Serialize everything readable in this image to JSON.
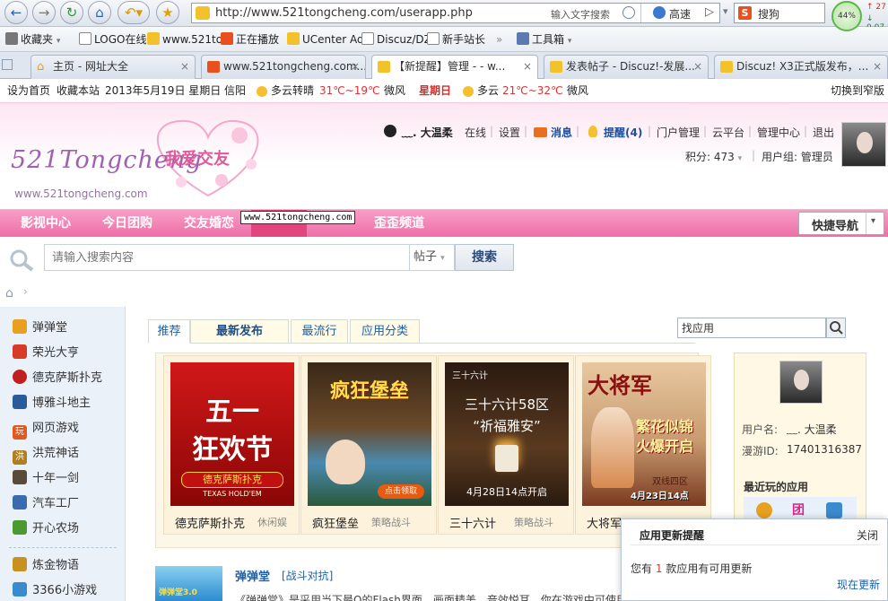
{
  "browser": {
    "url": "http://www.521tongcheng.com/userapp.php",
    "url_hint": "输入文字搜索",
    "speed_label": "高速",
    "search_engine_label": "搜狗",
    "progress_percent_label": "44%",
    "speed_up": "27",
    "speed_down": "0.07"
  },
  "bookmarks": [
    "收藏夹",
    "LOGO在线",
    "www.521to",
    "正在播放",
    "UCenter Ad",
    "Discuz/DZ",
    "新手站长",
    "工具箱"
  ],
  "tabs": [
    {
      "label": "主页 - 网址大全",
      "active": false
    },
    {
      "label": "www.521tongcheng.com...",
      "active": false
    },
    {
      "label": "【新提醒】管理 - - w...",
      "active": true
    },
    {
      "label": "发表帖子 - Discuz!-发展...",
      "active": false
    },
    {
      "label": "Discuz! X3正式版发布，..."
    }
  ],
  "topinfo": {
    "set_home": "设为首页",
    "bookmark_site": "收藏本站",
    "date": "2013年5月19日 星期日",
    "city": "信阳",
    "weather1": "多云转晴",
    "temp1": "31℃~19℃",
    "wind1": "微风",
    "day2": "星期日",
    "weather2": "多云",
    "temp2": "21℃~32℃",
    "wind2": "微风",
    "switch_narrow": "切换到窄版"
  },
  "logo": {
    "main": "521Tongcheng",
    "slogan": "我爱交友",
    "domain": "www.521tongcheng.com"
  },
  "user_nav": {
    "username": "﹏. 大温柔",
    "status": "在线",
    "settings": "设置",
    "messages": "消息",
    "alerts": "提醒(4)",
    "portal_admin": "门户管理",
    "cloud": "云平台",
    "admin_center": "管理中心",
    "logout": "退出",
    "points": "积分: 473",
    "user_group": "用户组: 管理员"
  },
  "menu": {
    "items": [
      "影视中心",
      "今日团购",
      "交友婚恋",
      "",
      "",
      "歪歪频道"
    ],
    "tooltip": "www.521tongcheng.com",
    "quick_nav": "快捷导航"
  },
  "search": {
    "placeholder": "请输入搜索内容",
    "type": "帖子",
    "button": "搜索"
  },
  "sidebar": {
    "items": [
      {
        "label": "弹弹堂",
        "color": "#e8a020"
      },
      {
        "label": "荣光大亨",
        "color": "#d83a2a"
      },
      {
        "label": "德克萨斯扑克",
        "color": "#c02020"
      },
      {
        "label": "博雅斗地主",
        "color": "#2a5a9a"
      },
      {
        "label": "网页游戏",
        "color": "#e05a20"
      },
      {
        "label": "洪荒神话",
        "color": "#b08020"
      },
      {
        "label": "十年一剑",
        "color": "#5a4a3a"
      },
      {
        "label": "汽车工厂",
        "color": "#3a6ab0"
      },
      {
        "label": "开心农场",
        "color": "#4a9a30"
      },
      {
        "label": "炼金物语",
        "color": "#c89020"
      },
      {
        "label": "3366小游戏",
        "color": "#3a8ad0"
      }
    ]
  },
  "app_tabs": [
    "推荐",
    "最新发布",
    "最流行",
    "应用分类"
  ],
  "app_search_placeholder": "找应用",
  "games": [
    {
      "name": "德克萨斯扑克",
      "type": "休闲娱",
      "banner_line1": "五一",
      "banner_line2": "狂欢节",
      "banner_sub": "德克萨斯扑克",
      "banner_sub2": "TEXAS HOLD'EM"
    },
    {
      "name": "疯狂堡垒",
      "type": "策略战斗",
      "banner_line1": "疯狂堡垒",
      "banner_sub": "点击领取"
    },
    {
      "name": "三十六计",
      "type": "策略战斗",
      "banner_line1": "三十六计",
      "banner_line2": "三十六计58区",
      "banner_line3": "“祈福雅安”",
      "banner_sub": "4月28日14点开启"
    },
    {
      "name": "大将军",
      "type": "",
      "banner_line1": "大将军",
      "banner_line2": "繁花似锦",
      "banner_line3": "火爆开启",
      "banner_sub": "双线四区",
      "banner_sub2": "4月23日14点"
    }
  ],
  "user_panel": {
    "username_label": "用户名:",
    "username": "﹏. 大温柔",
    "manyou_label": "漫游ID:",
    "manyou_id": "17401316387",
    "recent_apps": "最近玩的应用",
    "recent_app_glyph": "团"
  },
  "featured": {
    "title": "弹弹堂",
    "tag": "[战斗对抗]",
    "desc": "《弹弹堂》是采用当下最Q的Flash界面，画面精美，音效悦耳，你在游戏中可使用",
    "thumb_text": "弹弹堂3.0"
  },
  "popup": {
    "title": "应用更新提醒",
    "close": "关闭",
    "msg_before": "您有",
    "count": "1",
    "msg_after": "款应用有可用更新",
    "update_now": "现在更新"
  }
}
